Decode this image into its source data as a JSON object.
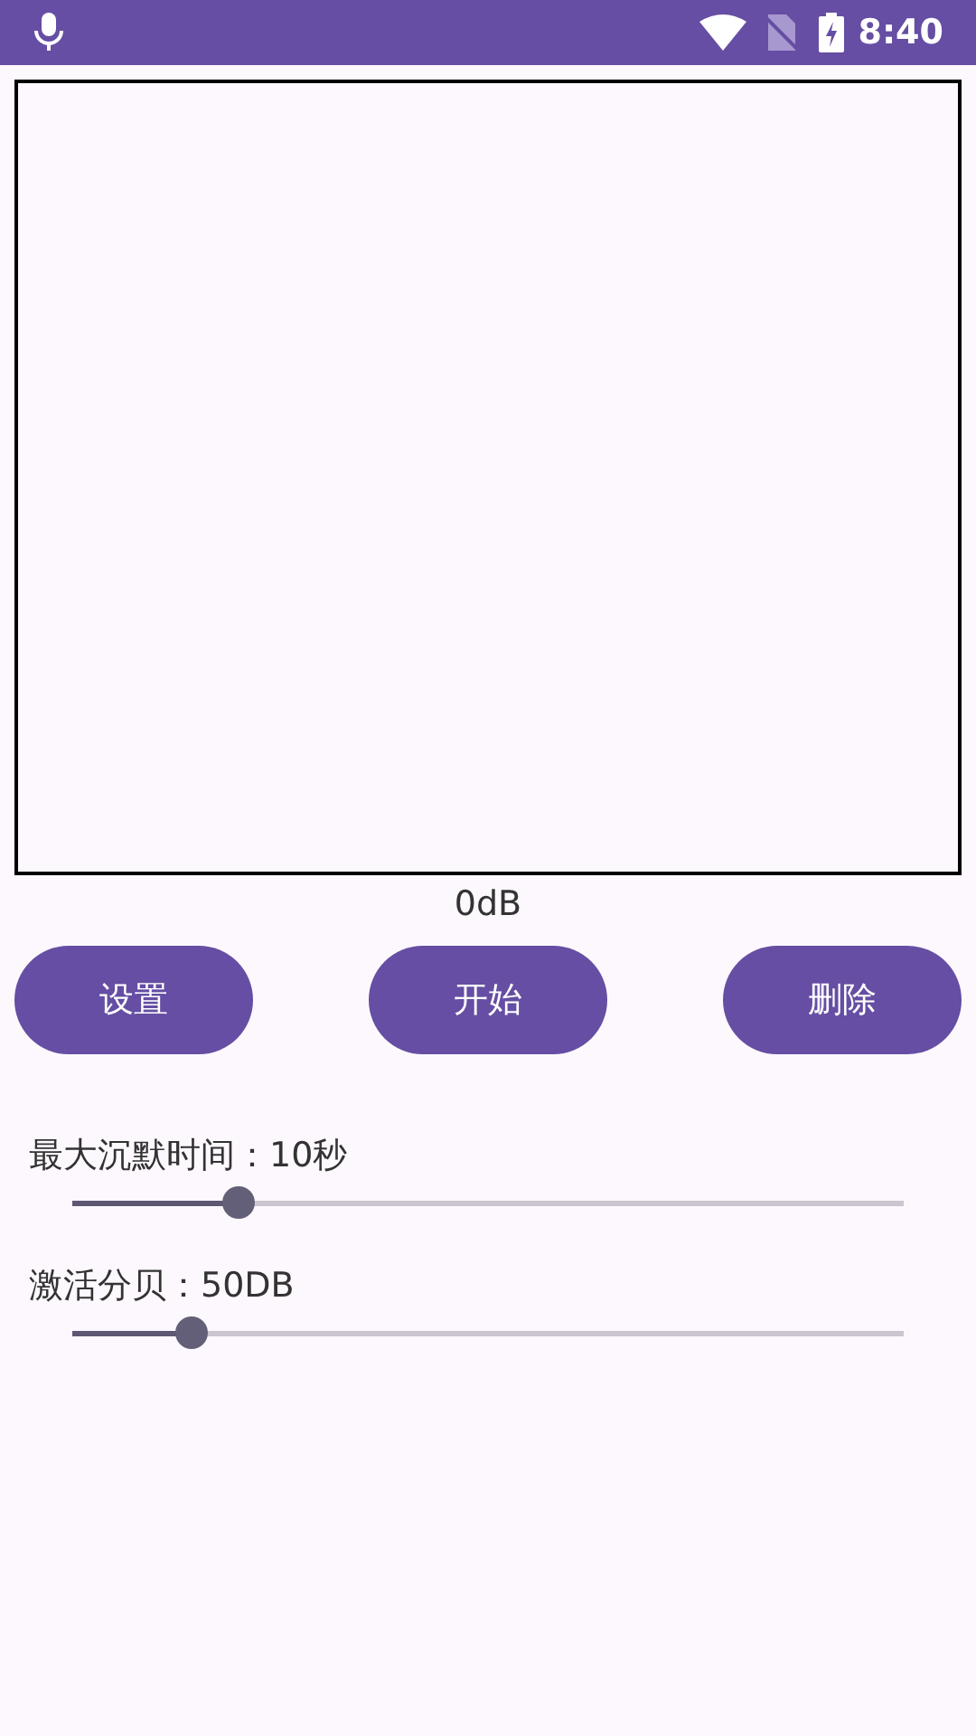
{
  "status_bar": {
    "time": "8:40"
  },
  "meter": {
    "reading": "0dB"
  },
  "buttons": [
    "设置",
    "开始",
    "删除"
  ],
  "sliders": [
    {
      "label": "最大沉默时间：10秒",
      "level": 0.2
    },
    {
      "label": "激活分贝：50DB",
      "level": 0.143
    }
  ]
}
